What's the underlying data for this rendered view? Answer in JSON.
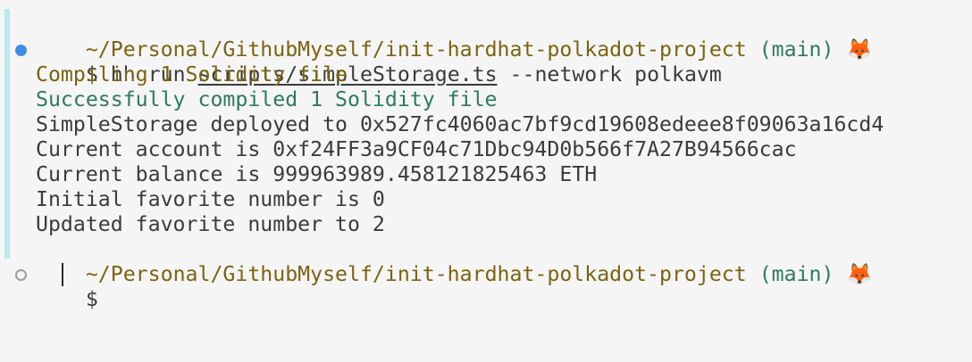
{
  "prompt1": {
    "path": "~/Personal/GithubMyself/init-hardhat-polkadot-project",
    "branch": "(main)",
    "emoji": "🦊"
  },
  "command": {
    "symbol": "$",
    "program": "hh run",
    "script": "scripts/simpleStorage.ts",
    "flags": "--network polkavm"
  },
  "output": [
    "Compiling 1 Solidity file",
    "Successfully compiled 1 Solidity file",
    "SimpleStorage deployed to 0x527fc4060ac7bf9cd19608edeee8f09063a16cd4",
    "Current account is 0xf24FF3a9CF04c71Dbc94D0b566f7A27B94566cac",
    "Current balance is 999963989.458121825463 ETH",
    "Initial favorite number is 0",
    "Updated favorite number to 2"
  ],
  "prompt2": {
    "path": "~/Personal/GithubMyself/init-hardhat-polkadot-project",
    "branch": "(main)",
    "emoji": "🦊"
  },
  "input": {
    "symbol": "$",
    "value": ""
  },
  "colors": {
    "background": "#f5f5f5",
    "path": "#7a6410",
    "branch": "#2e7a5e",
    "success": "#2e7a5e",
    "active_marker": "#3f8ee5",
    "block_bar": "#b9e9ee"
  }
}
